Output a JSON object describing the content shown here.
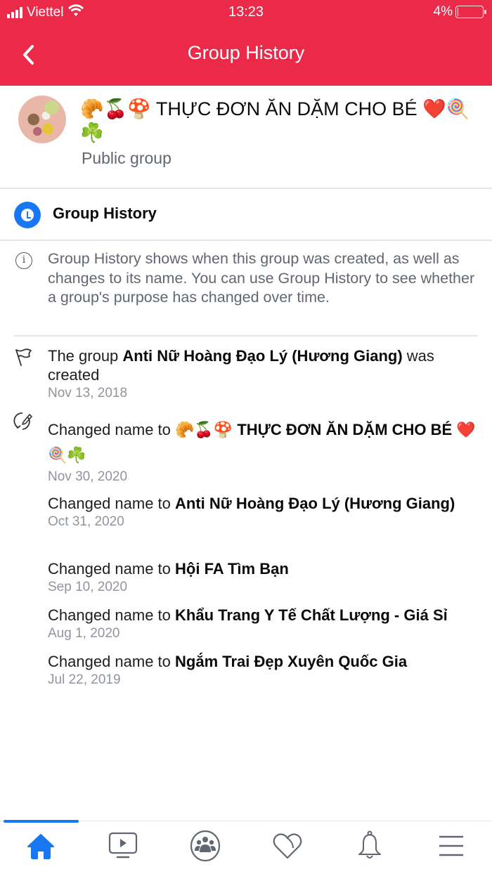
{
  "status_bar": {
    "carrier": "Viettel",
    "time": "13:23",
    "battery_percent_label": "4%",
    "battery_level": 0.04
  },
  "header": {
    "title": "Group History",
    "back_icon": "chevron-left-icon"
  },
  "group": {
    "name": "🥐🍒🍄 THỰC ĐƠN ĂN DẶM CHO BÉ ❤️🍭☘️",
    "type": "Public group"
  },
  "section": {
    "icon": "clock-icon",
    "title": "Group History"
  },
  "info": {
    "icon": "info-icon",
    "text": "Group History shows when this group was created, as well as changes to its name. You can use Group History to see whether a group's purpose has changed over time."
  },
  "events": [
    {
      "icon": "flag-icon",
      "prefix": "The group ",
      "name": "Anti Nữ Hoàng Đạo Lý (Hương Giang)",
      "suffix": " was created",
      "date": "Nov 13, 2018"
    },
    {
      "icon": "edit-name-icon",
      "prefix": "Changed name to ",
      "name": "🥐🍒🍄 THỰC ĐƠN ĂN DẶM CHO BÉ ❤️🍭☘️",
      "suffix": "",
      "date": "Nov 30, 2020"
    },
    {
      "prefix": "Changed name to ",
      "name": "Anti Nữ Hoàng Đạo Lý (Hương Giang)",
      "suffix": "",
      "date": "Oct 31, 2020"
    },
    {
      "prefix": "Changed name to ",
      "name": "Hội FA Tìm Bạn",
      "suffix": "",
      "date": "Sep 10, 2020"
    },
    {
      "prefix": "Changed name to ",
      "name": "Khẩu Trang Y Tế Chất Lượng - Giá Sỉ",
      "suffix": "",
      "date": "Aug 1, 2020"
    },
    {
      "prefix": "Changed name to ",
      "name": "Ngắm Trai Đẹp Xuyên Quốc Gia",
      "suffix": "",
      "date": "Jul 22, 2019"
    }
  ],
  "tabbar": {
    "active": "home",
    "accent_color": "#1877f2",
    "items": [
      {
        "id": "home",
        "icon": "home-icon"
      },
      {
        "id": "watch",
        "icon": "video-icon"
      },
      {
        "id": "groups",
        "icon": "groups-icon"
      },
      {
        "id": "dating",
        "icon": "heart-icon"
      },
      {
        "id": "notifications",
        "icon": "bell-icon"
      },
      {
        "id": "menu",
        "icon": "menu-icon"
      }
    ]
  },
  "colors": {
    "header_bg": "#eb2a4a",
    "accent": "#1877f2",
    "secondary_text": "#606770",
    "date_text": "#90949c"
  }
}
